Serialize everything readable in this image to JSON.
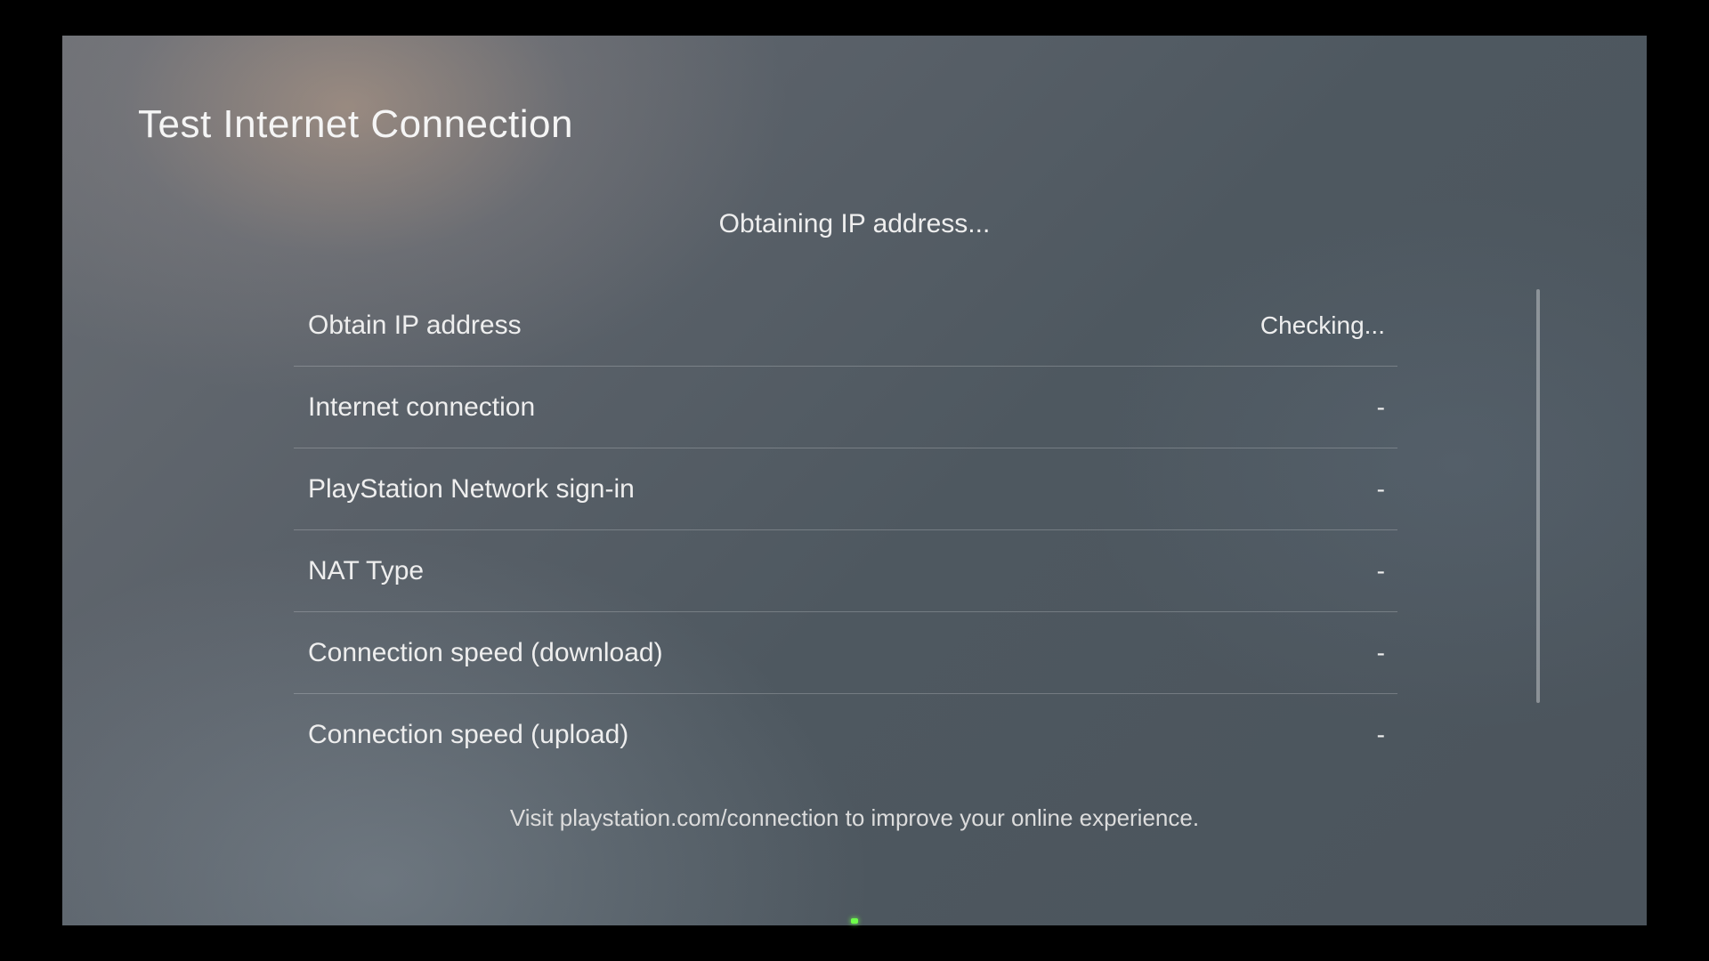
{
  "header": {
    "title": "Test Internet Connection"
  },
  "status": {
    "message": "Obtaining IP address..."
  },
  "tests": [
    {
      "label": "Obtain IP address",
      "value": "Checking..."
    },
    {
      "label": "Internet connection",
      "value": "-"
    },
    {
      "label": "PlayStation Network sign-in",
      "value": "-"
    },
    {
      "label": "NAT Type",
      "value": "-"
    },
    {
      "label": "Connection speed (download)",
      "value": "-"
    },
    {
      "label": "Connection speed (upload)",
      "value": "-"
    }
  ],
  "footer": {
    "hint": "Visit playstation.com/connection to improve your online experience."
  }
}
